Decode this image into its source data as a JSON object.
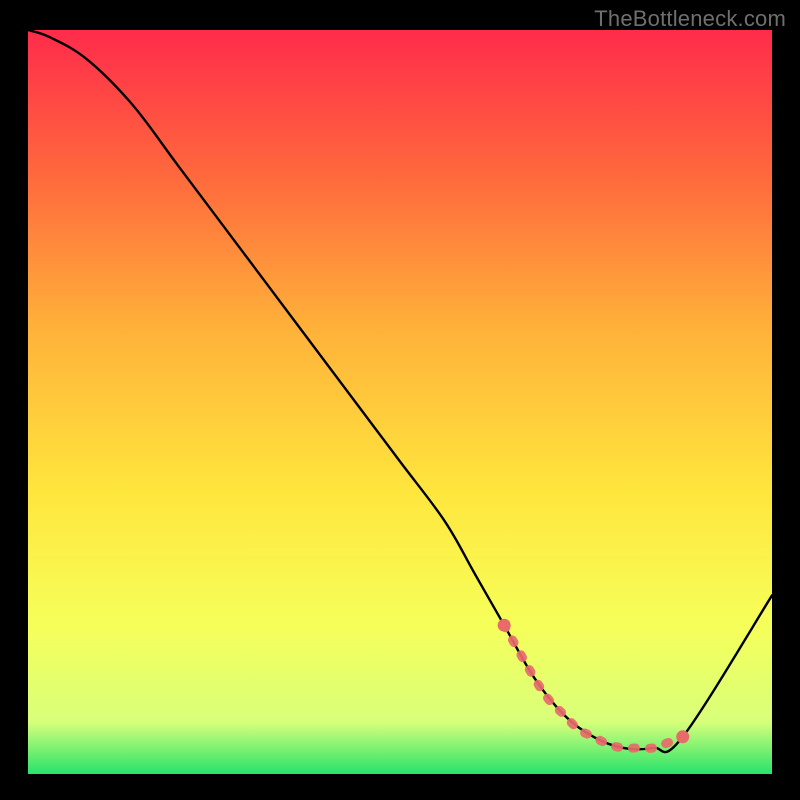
{
  "watermark": "TheBottleneck.com",
  "colors": {
    "page_bg": "#000000",
    "gradient_top": "#ff2b4b",
    "gradient_mid1": "#ff6a3d",
    "gradient_mid2": "#ffb13a",
    "gradient_mid3": "#ffe63d",
    "gradient_mid4": "#f6ff5a",
    "gradient_low": "#d8ff7a",
    "gradient_bottom": "#27e36b",
    "curve": "#000000",
    "marker_fill": "#e86a6b",
    "marker_stroke": "#c94f51"
  },
  "chart_data": {
    "type": "line",
    "title": "",
    "xlabel": "",
    "ylabel": "",
    "xlim": [
      0,
      100
    ],
    "ylim": [
      0,
      100
    ],
    "series": [
      {
        "name": "bottleneck-curve",
        "x": [
          0,
          3,
          8,
          14,
          20,
          26,
          32,
          38,
          44,
          50,
          56,
          60,
          64,
          68,
          72,
          76,
          80,
          84,
          88,
          100
        ],
        "y": [
          100,
          99,
          96,
          90,
          82,
          74,
          66,
          58,
          50,
          42,
          34,
          27,
          20,
          13,
          8,
          5,
          3.5,
          3.5,
          5,
          24
        ]
      }
    ],
    "markers": {
      "name": "highlighted-range",
      "x": [
        64,
        68,
        70,
        72,
        74,
        76,
        78,
        80,
        82,
        84,
        86,
        88
      ],
      "y": [
        20,
        13,
        10,
        8,
        6,
        5,
        4,
        3.5,
        3.5,
        3.5,
        4.2,
        5
      ]
    }
  }
}
